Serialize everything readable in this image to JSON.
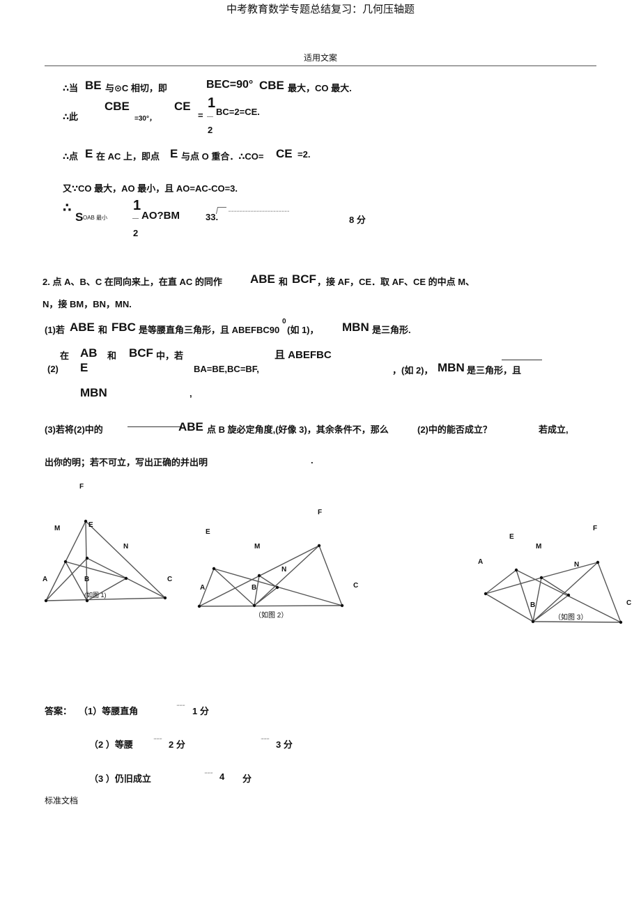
{
  "header": {
    "doc_title": "中考教育数学专题总结复习：几何压轴题",
    "subtitle": "适用文案"
  },
  "solution": {
    "l1_a": "∴当",
    "l1_b": "BE",
    "l1_c": "与⊙C 相切，即",
    "l1_d": "BEC=90°",
    "l1_e": "CBE",
    "l1_f": "最大，CO 最大.",
    "l2_a": "∴此",
    "l2_b": "CBE",
    "l2_c": "=30°，",
    "l2_d": "CE",
    "l2_e": "=",
    "l2_num": "1",
    "l2_den": "2",
    "l2_f": "BC=2=CE.",
    "l3_a": "∴点",
    "l3_b": "E",
    "l3_c": "在 AC 上，即点",
    "l3_d": "E",
    "l3_e": "与点 O 重合．∴CO=",
    "l3_f": "CE",
    "l3_g": "=2.",
    "l4": "又∵CO 最大，AO 最小，且 AO=AC-CO=3.",
    "l5_a": "∴",
    "l5_b": "S",
    "l5_c": "OAB 最小",
    "l5_num": "1",
    "l5_den": "2",
    "l5_d": "AO?BM",
    "l5_e": "33.",
    "l5_dots": "··································································",
    "l5_f": "8 分"
  },
  "problem": {
    "p1_a": "2.  点 A、B、C 在同向来上，在直 AC 的同作",
    "p1_b": "ABE",
    "p1_c": "和",
    "p1_d": "BCF",
    "p1_e": "，接 AF，CE．取 AF、CE 的中点 M、",
    "p2": "N，接 BM，BN，MN.",
    "q1_a": "(1)若",
    "q1_b": "ABE",
    "q1_c": "和",
    "q1_d": "FBC",
    "q1_e": "是等腰直角三角形，且 ABEFBC90",
    "q1_sup": "0",
    "q1_f": "(如 1)，",
    "q1_g": "MBN",
    "q1_h": "是三角形.",
    "q2_num": "(2)",
    "q2_zai": "在",
    "q2_ab": "AB",
    "q2_e": "E",
    "q2_he": "和",
    "q2_bcf": "BCF",
    "q2_ruo": "中，若",
    "q2_qie": "且 ABEFBC",
    "q2_cond": "BA=BE,BC=BF,",
    "q2_ru": "，(如 2)，",
    "q2_mbn": "MBN",
    "q2_tail": "是三角形，且",
    "q2_mbn2": "MBN",
    "q2_comma": ",",
    "q3_a": "(3)若将(2)中的",
    "q3_b": "ABE",
    "q3_c": "点 B 旋必定角度,(好像 3)，其余条件不，那么",
    "q3_d": "(2)中的能否成立？",
    "q3_e": "若成立,",
    "q3_f": "出你的明；若不可立，写出正确的并出明",
    "q3_g": "."
  },
  "figures": [
    {
      "caption": "(如图 1)",
      "labels": {
        "F": "F",
        "M": "M",
        "E": "E",
        "N": "N",
        "A": "A",
        "B": "B",
        "C": "C"
      }
    },
    {
      "caption": "（如图 2）",
      "labels": {
        "F": "F",
        "E": "E",
        "M": "M",
        "N": "N",
        "A": "A",
        "B": "B",
        "C": "C"
      }
    },
    {
      "caption": "（如图 3）",
      "labels": {
        "F": "F",
        "E": "E",
        "M": "M",
        "N": "N",
        "A": "A",
        "B": "B",
        "C": "C"
      }
    }
  ],
  "answers": {
    "label": "答案：",
    "a1": "（1）等腰直角",
    "a1_dots": "·········",
    "a1_score": "1 分",
    "a2": "（2 ）等腰",
    "a2_dots": "·········",
    "a2_score": "2 分",
    "a2b_dots": "·········",
    "a2b_score": "3 分",
    "a3": "（3 ）仍旧成立",
    "a3_dots": "·········",
    "a3_score": "4",
    "a3_unit": "分"
  },
  "footer": {
    "text": "标准文档"
  }
}
